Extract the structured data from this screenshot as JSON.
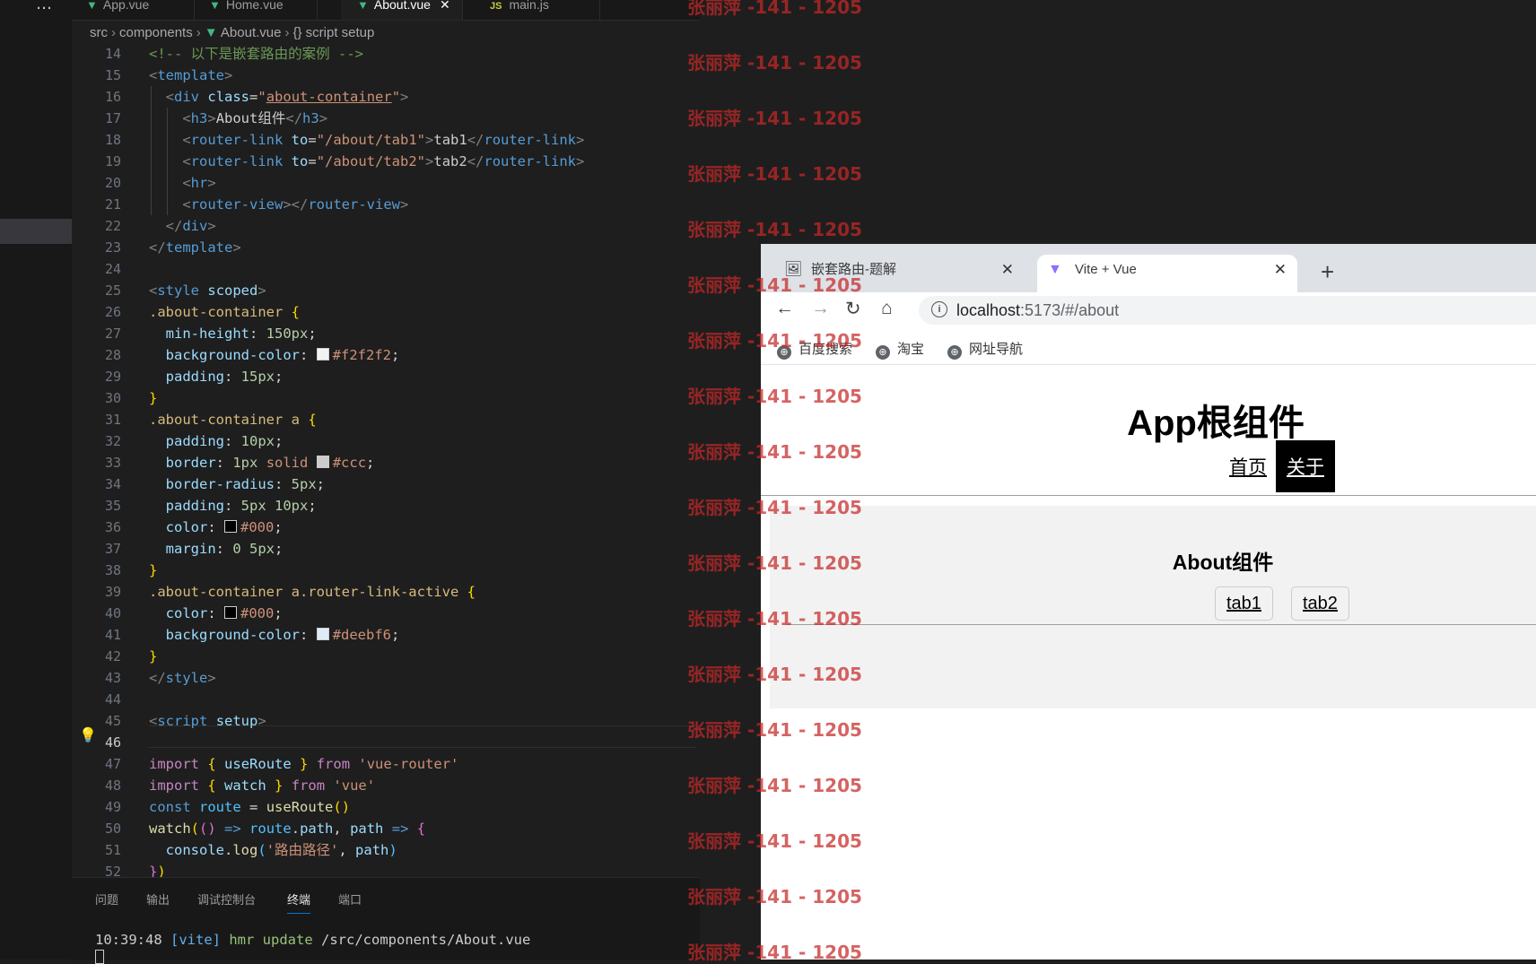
{
  "editor": {
    "more_icon": "…",
    "tabs": [
      {
        "label": "App.vue",
        "icon": "vue"
      },
      {
        "label": "Home.vue",
        "icon": "vue"
      },
      {
        "label": "About.vue",
        "icon": "vue",
        "active": true
      },
      {
        "label": "main.js",
        "icon": "js"
      }
    ],
    "close_icon": "✕",
    "breadcrumb": [
      "src",
      "components",
      "About.vue",
      "{} script setup"
    ],
    "line_numbers": [
      "14",
      "15",
      "16",
      "17",
      "18",
      "19",
      "20",
      "21",
      "22",
      "23",
      "24",
      "25",
      "26",
      "27",
      "28",
      "29",
      "30",
      "31",
      "32",
      "33",
      "34",
      "35",
      "36",
      "37",
      "38",
      "39",
      "40",
      "41",
      "42",
      "43",
      "44",
      "45",
      "46",
      "47",
      "48",
      "49",
      "50",
      "51",
      "52"
    ],
    "current_line": "46",
    "colors": {
      "swatch_f2": "#f2f2f2",
      "swatch_ccc": "#cccccc",
      "swatch_000": "#000000",
      "swatch_deebf6": "#deebf6"
    },
    "code": {
      "l14": "<!-- 以下是嵌套路由的案例 -->",
      "l16_cls": "about-container",
      "l17_text": "About组件",
      "l18_to": "\"/about/tab1\"",
      "l18_text": "tab1",
      "l19_to": "\"/about/tab2\"",
      "l19_text": "tab2",
      "l26": ".about-container",
      "l27_v": "150px",
      "l28_v": "#f2f2f2",
      "l29_v": "15px",
      "l31": ".about-container a",
      "l32_v": "10px",
      "l33_v1": "1px",
      "l33_v2": "solid",
      "l33_v3": "#ccc",
      "l34_v": "5px",
      "l35_v": "5px 10px",
      "l36_v": "#000",
      "l37_v": "0 5px",
      "l39": ".about-container a.router-link-active",
      "l40_v": "#000",
      "l41_v": "#deebf6",
      "l47_mod": "'vue-router'",
      "l48_mod": "'vue'",
      "l51_str": "'路由路径'"
    }
  },
  "panel": {
    "tabs": [
      "问题",
      "输出",
      "调试控制台",
      "终端",
      "端口"
    ],
    "active_tab": "终端",
    "terminal": {
      "time": "10:39:48",
      "tag": "[vite]",
      "event": "hmr update",
      "path": "/src/components/About.vue"
    }
  },
  "browser": {
    "tabs": [
      {
        "label": "嵌套路由-题解",
        "icon": "image-favicon"
      },
      {
        "label": "Vite + Vue",
        "icon": "vite-favicon",
        "active": true
      }
    ],
    "close_icon": "✕",
    "new_tab_icon": "+",
    "nav": {
      "back": "←",
      "forward": "→",
      "reload": "↻",
      "home": "⌂"
    },
    "url_host": "localhost",
    "url_rest": ":5173/#/about",
    "bookmarks": [
      "百度搜索",
      "淘宝",
      "网址导航"
    ],
    "page": {
      "title": "App根组件",
      "nav_links": [
        "首页",
        "关于"
      ],
      "about_title": "About组件",
      "tab_links": [
        "tab1",
        "tab2"
      ]
    }
  },
  "watermark": "张丽萍 -141 - 1205"
}
